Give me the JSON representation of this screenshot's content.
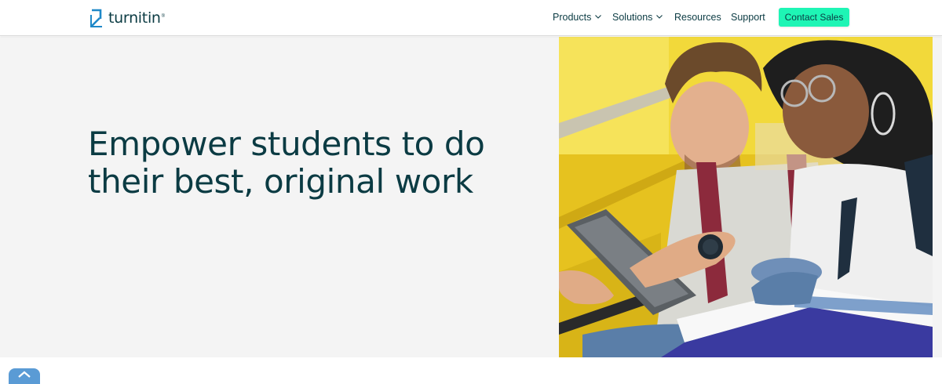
{
  "brand": {
    "name": "turnitin",
    "logo_icon": "turnitin-logo-mark",
    "colors": {
      "primary_text": "#0b3b43",
      "accent": "#1ef5b5",
      "logo_blue": "#1e88c8"
    }
  },
  "nav": {
    "items": [
      {
        "label": "Products",
        "has_dropdown": true
      },
      {
        "label": "Solutions",
        "has_dropdown": true
      },
      {
        "label": "Resources",
        "has_dropdown": false
      },
      {
        "label": "Support",
        "has_dropdown": false
      }
    ],
    "cta_label": "Contact Sales"
  },
  "hero": {
    "title": "Empower students to do their best, original work",
    "image_alt": "two-students-with-tablet-and-book"
  },
  "footer_widget": {
    "icon": "chat-badge-icon"
  }
}
